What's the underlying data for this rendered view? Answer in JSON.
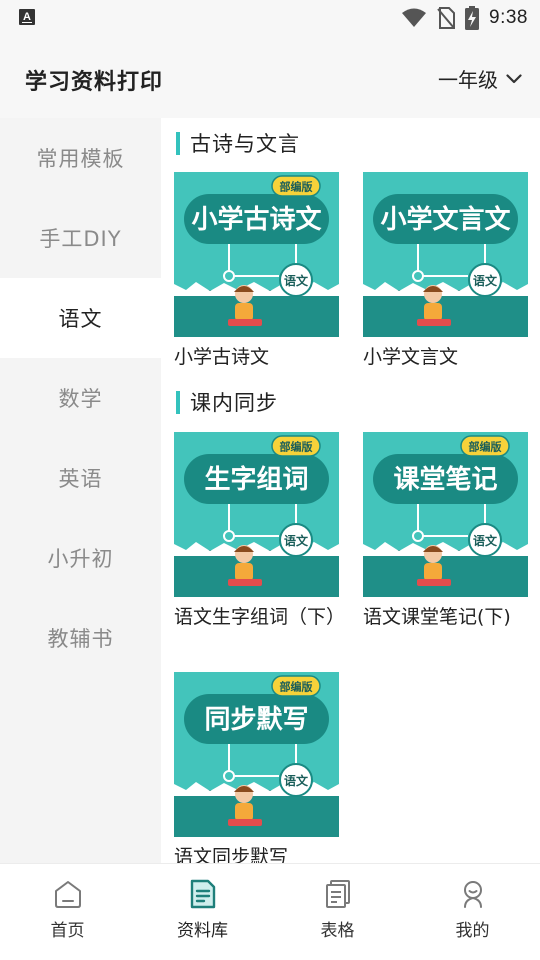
{
  "status_bar": {
    "app_indicator": "A",
    "time": "9:38",
    "icons": [
      "wifi-icon",
      "no-sim-icon",
      "battery-charging-icon"
    ]
  },
  "header": {
    "title": "学习资料打印",
    "grade": "一年级"
  },
  "sidebar": {
    "items": [
      {
        "label": "常用模板"
      },
      {
        "label": "手工DIY"
      },
      {
        "label": "语文"
      },
      {
        "label": "数学"
      },
      {
        "label": "英语"
      },
      {
        "label": "小升初"
      },
      {
        "label": "教辅书"
      }
    ],
    "active_index": 2
  },
  "content": {
    "sections": [
      {
        "title": "古诗与文言",
        "cards": [
          {
            "label": "小学古诗文",
            "thumb_title": "小学古诗文",
            "badge": "部编版",
            "subject": "语文"
          },
          {
            "label": "小学文言文",
            "thumb_title": "小学文言文",
            "badge": "",
            "subject": "语文"
          }
        ]
      },
      {
        "title": "课内同步",
        "cards": [
          {
            "label": "语文生字组词（下）",
            "thumb_title": "生字组词",
            "badge": "部编版",
            "subject": "语文"
          },
          {
            "label": "语文课堂笔记(下)",
            "thumb_title": "课堂笔记",
            "badge": "部编版",
            "subject": "语文"
          },
          {
            "label": "语文同步默写",
            "thumb_title": "同步默写",
            "badge": "部编版",
            "subject": "语文"
          }
        ]
      }
    ]
  },
  "tabbar": {
    "tabs": [
      {
        "label": "首页",
        "icon": "home-icon"
      },
      {
        "label": "资料库",
        "icon": "document-icon"
      },
      {
        "label": "表格",
        "icon": "sheet-icon"
      },
      {
        "label": "我的",
        "icon": "profile-icon"
      }
    ],
    "active_index": 1
  },
  "colors": {
    "accent": "#33c2bd",
    "thumb_bg": "#3bbdb4",
    "thumb_dark": "#1f8f88",
    "active_tab_icon": "#1e7f7a"
  }
}
